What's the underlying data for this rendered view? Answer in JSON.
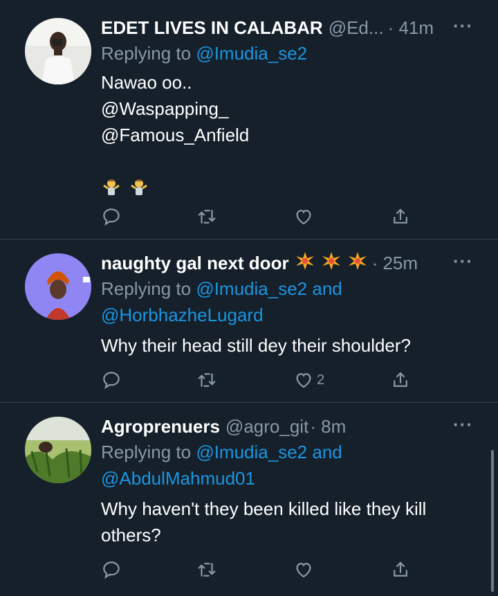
{
  "tweets": [
    {
      "name": "EDET LIVES IN CALABAR",
      "handle": "@Ed...",
      "time": "· 41m",
      "more": "···",
      "reply_prefix": "Replying to",
      "reply_handle": "@Imudia_se2",
      "reply_extra": "",
      "reply_line2": "",
      "body": "Nawao oo..",
      "mentions": [
        "@Waspapping_",
        "@Famous_Anfield"
      ],
      "emoji": "shrugging-person",
      "likes": ""
    },
    {
      "name": "naughty gal next door",
      "handle": "",
      "time": "· 25m",
      "more": "···",
      "reply_prefix": "Replying to",
      "reply_handle": "@Imudia_se2",
      "reply_extra": "and",
      "reply_line2": "@HorbhazheLugard",
      "body": "Why their head still dey their shoulder?",
      "mentions": [],
      "emoji": "collision-spark",
      "likes": "2"
    },
    {
      "name": "Agroprenuers",
      "handle": "@agro_git",
      "time": "· 8m",
      "more": "···",
      "reply_prefix": "Replying to",
      "reply_handle": "@Imudia_se2",
      "reply_extra": "and",
      "reply_line2": "@AbdulMahmud01",
      "body_line1": "Why haven't they been killed like they kill",
      "body_line2": "others?",
      "mentions": [],
      "likes": ""
    }
  ],
  "colors": {
    "background": "#15202b",
    "link": "#1b95e0",
    "muted": "#8899a6",
    "divider": "#38444d"
  }
}
